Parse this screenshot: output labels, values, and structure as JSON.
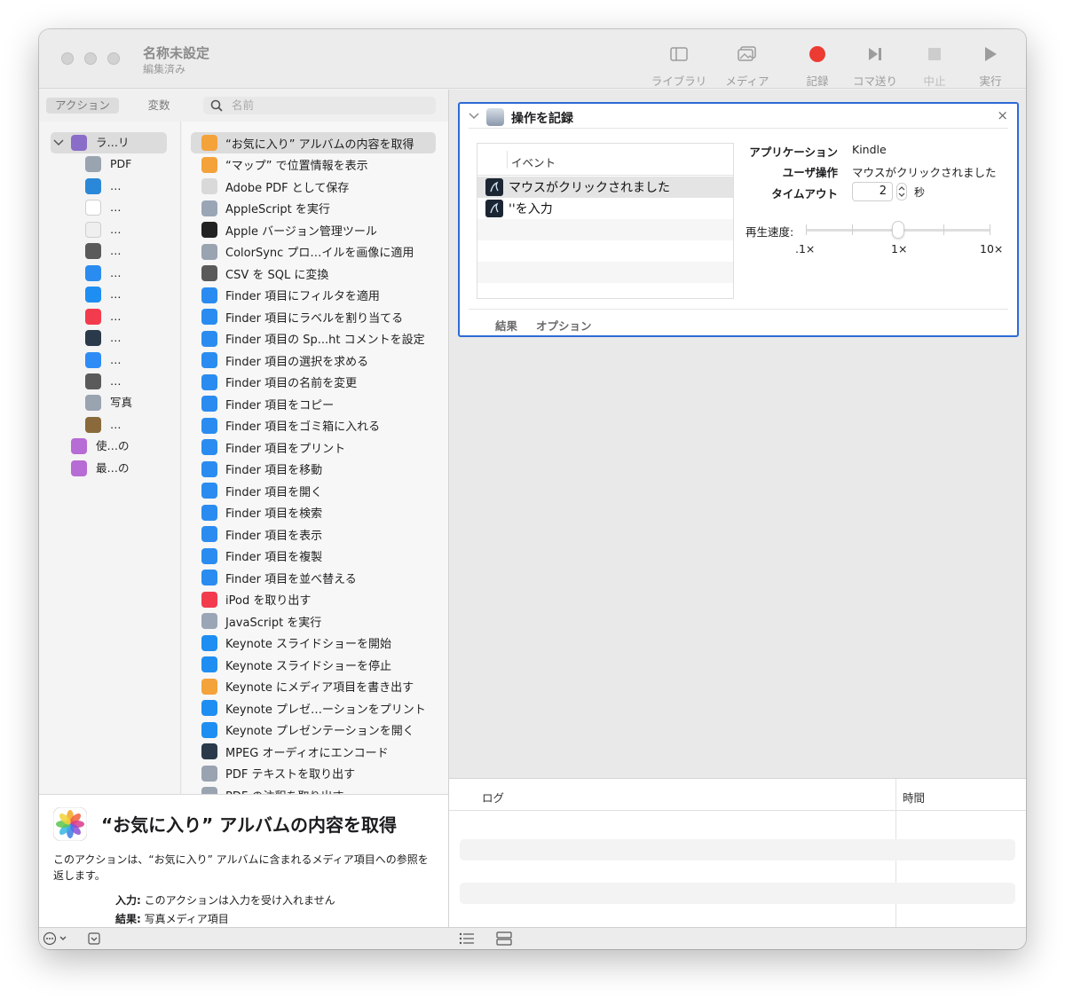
{
  "window": {
    "title": "名称未設定",
    "subtitle": "編集済み"
  },
  "toolbar": [
    {
      "label": "ライブラリ",
      "icon": "sidebar-icon"
    },
    {
      "label": "メディア",
      "icon": "media-icon"
    },
    {
      "label": "記録",
      "icon": "record-icon"
    },
    {
      "label": "コマ送り",
      "icon": "step-icon"
    },
    {
      "label": "中止",
      "icon": "stop-icon"
    },
    {
      "label": "実行",
      "icon": "run-icon"
    }
  ],
  "colors": {
    "record": "#ec3b32",
    "selection_border": "#2d6ad6"
  },
  "left": {
    "tabs": [
      "アクション",
      "変数"
    ],
    "search_placeholder": "名前"
  },
  "library": [
    {
      "label": "ラ…リ",
      "icon": "library-icon",
      "color": "#8a6cc9",
      "level": 0
    },
    {
      "label": "PDF",
      "icon": "pdf-icon",
      "color": "#9aa3b0",
      "level": 1
    },
    {
      "label": "…",
      "icon": "internet-icon",
      "color": "#2b88d8",
      "level": 1
    },
    {
      "label": "…",
      "icon": "calendar-icon",
      "color": "#ffffff",
      "level": 1
    },
    {
      "label": "…",
      "icon": "text-icon",
      "color": "#efefef",
      "level": 1
    },
    {
      "label": "…",
      "icon": "utilities-icon",
      "color": "#5a5a5a",
      "level": 1
    },
    {
      "label": "…",
      "icon": "finder-icon",
      "color": "#2a8cf0",
      "level": 1
    },
    {
      "label": "…",
      "icon": "presentation-icon",
      "color": "#1f8ef2",
      "level": 1
    },
    {
      "label": "…",
      "icon": "music-icon",
      "color": "#f23c4e",
      "level": 1
    },
    {
      "label": "…",
      "icon": "movie-icon",
      "color": "#2a3a4a",
      "level": 1
    },
    {
      "label": "…",
      "icon": "mail-icon",
      "color": "#2f8cf6",
      "level": 1
    },
    {
      "label": "…",
      "icon": "developer-icon",
      "color": "#5a5a5a",
      "level": 1
    },
    {
      "label": "写真",
      "icon": "photos-icon",
      "color": "#9aa3b0",
      "level": 1
    },
    {
      "label": "…",
      "icon": "other-icon",
      "color": "#8a6a3a",
      "level": 1
    },
    {
      "label": "使…の",
      "icon": "smart-folder-icon",
      "color": "#b76bd4",
      "level": 0
    },
    {
      "label": "最…の",
      "icon": "smart-folder-icon",
      "color": "#b76bd4",
      "level": 0
    }
  ],
  "actions": [
    {
      "label": "“お気に入り” アルバムの内容を取得",
      "icon": "photos-icon",
      "color": "#f4a23a"
    },
    {
      "label": "“マップ” で位置情報を表示",
      "icon": "photos-icon",
      "color": "#f4a23a"
    },
    {
      "label": "Adobe PDF として保存",
      "icon": "pdf-icon",
      "color": "#d9d9d9"
    },
    {
      "label": "AppleScript を実行",
      "icon": "script-icon",
      "color": "#9aa6b6"
    },
    {
      "label": "Apple バージョン管理ツール",
      "icon": "terminal-icon",
      "color": "#222222"
    },
    {
      "label": "ColorSync プロ…イルを画像に適用",
      "icon": "colorsync-icon",
      "color": "#9aa3b0"
    },
    {
      "label": "CSV を SQL に変換",
      "icon": "utilities-icon",
      "color": "#5a5a5a"
    },
    {
      "label": "Finder 項目にフィルタを適用",
      "icon": "finder-icon",
      "color": "#2a8cf0"
    },
    {
      "label": "Finder 項目にラベルを割り当てる",
      "icon": "finder-icon",
      "color": "#2a8cf0"
    },
    {
      "label": "Finder 項目の Sp...ht コメントを設定",
      "icon": "finder-icon",
      "color": "#2a8cf0"
    },
    {
      "label": "Finder 項目の選択を求める",
      "icon": "finder-icon",
      "color": "#2a8cf0"
    },
    {
      "label": "Finder 項目の名前を変更",
      "icon": "finder-icon",
      "color": "#2a8cf0"
    },
    {
      "label": "Finder 項目をコピー",
      "icon": "finder-icon",
      "color": "#2a8cf0"
    },
    {
      "label": "Finder 項目をゴミ箱に入れる",
      "icon": "finder-icon",
      "color": "#2a8cf0"
    },
    {
      "label": "Finder 項目をプリント",
      "icon": "finder-icon",
      "color": "#2a8cf0"
    },
    {
      "label": "Finder 項目を移動",
      "icon": "finder-icon",
      "color": "#2a8cf0"
    },
    {
      "label": "Finder 項目を開く",
      "icon": "finder-icon",
      "color": "#2a8cf0"
    },
    {
      "label": "Finder 項目を検索",
      "icon": "finder-icon",
      "color": "#2a8cf0"
    },
    {
      "label": "Finder 項目を表示",
      "icon": "finder-icon",
      "color": "#2a8cf0"
    },
    {
      "label": "Finder 項目を複製",
      "icon": "finder-icon",
      "color": "#2a8cf0"
    },
    {
      "label": "Finder 項目を並べ替える",
      "icon": "finder-icon",
      "color": "#2a8cf0"
    },
    {
      "label": "iPod を取り出す",
      "icon": "music-icon",
      "color": "#f23c4e"
    },
    {
      "label": "JavaScript を実行",
      "icon": "script-icon",
      "color": "#9aa6b6"
    },
    {
      "label": "Keynote スライドショーを開始",
      "icon": "keynote-icon",
      "color": "#1f8ef2"
    },
    {
      "label": "Keynote スライドショーを停止",
      "icon": "keynote-icon",
      "color": "#1f8ef2"
    },
    {
      "label": "Keynote にメディア項目を書き出す",
      "icon": "photos-icon",
      "color": "#f4a23a"
    },
    {
      "label": "Keynote プレゼ…ーションをプリント",
      "icon": "keynote-icon",
      "color": "#1f8ef2"
    },
    {
      "label": "Keynote プレゼンテーションを開く",
      "icon": "keynote-icon",
      "color": "#1f8ef2"
    },
    {
      "label": "MPEG オーディオにエンコード",
      "icon": "quicktime-icon",
      "color": "#2a3a4a"
    },
    {
      "label": "PDF テキストを取り出す",
      "icon": "pdf-icon",
      "color": "#9aa3b0"
    },
    {
      "label": "PDF の注釈を取り出す",
      "icon": "pdf-icon",
      "color": "#9aa3b0"
    }
  ],
  "description": {
    "title": "“お気に入り” アルバムの内容を取得",
    "body": "このアクションは、“お気に入り” アルバムに含まれるメディア項目への参照を返します。",
    "input_label": "入力:",
    "input_value": "このアクションは入力を受け入れません",
    "result_label": "結果:",
    "result_value": "写真メディア項目"
  },
  "card": {
    "title": "操作を記録",
    "close": "×",
    "event_header": "イベント",
    "events": [
      "マウスがクリックされました",
      "''を入力"
    ],
    "props": {
      "app_label": "アプリケーション",
      "app_value": "Kindle",
      "op_label": "ユーザ操作",
      "op_value": "マウスがクリックされました",
      "timeout_label": "タイムアウト",
      "timeout_value": "2",
      "timeout_unit": "秒"
    },
    "speed_label": "再生速度:",
    "speed_ticks": [
      ".1×",
      "1×",
      "10×"
    ],
    "speed_value": 0.5,
    "tabs": [
      "結果",
      "オプション"
    ]
  },
  "log": {
    "col_log": "ログ",
    "col_time": "時間"
  }
}
